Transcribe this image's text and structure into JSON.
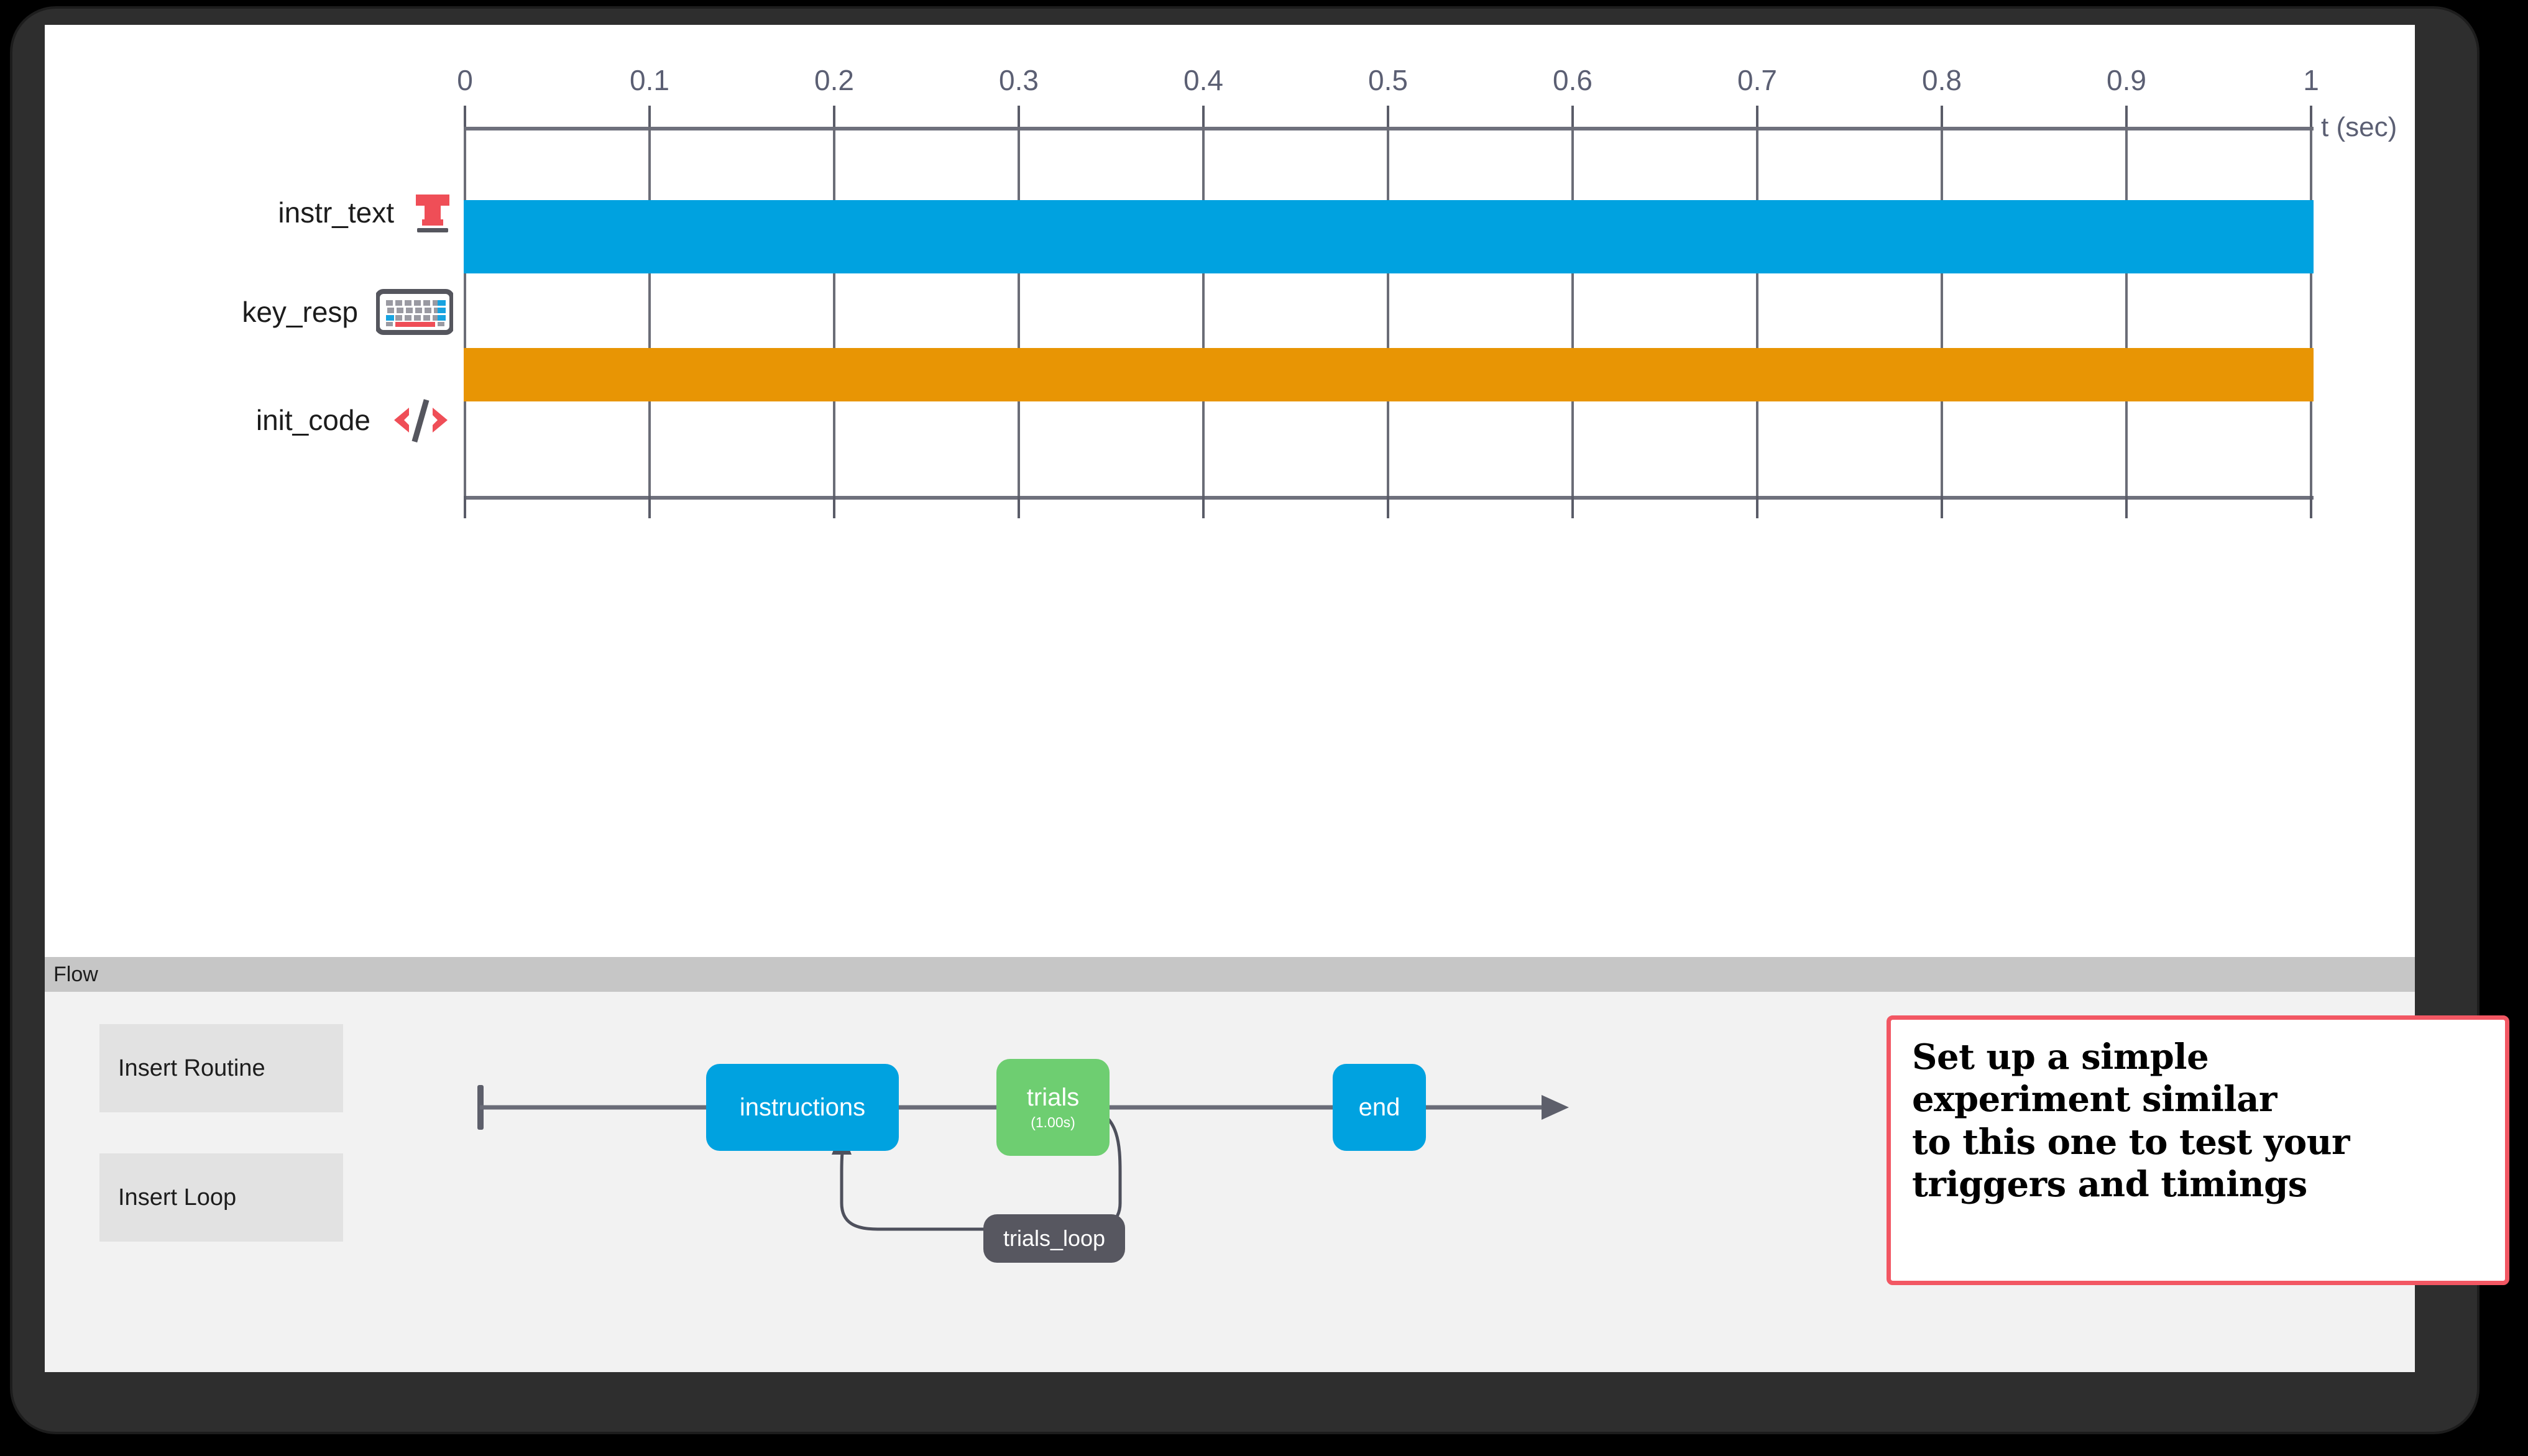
{
  "window": {
    "timeline_panel": {
      "axis": {
        "ticks": [
          "0",
          "0.1",
          "0.2",
          "0.3",
          "0.4",
          "0.5",
          "0.6",
          "0.7",
          "0.8",
          "0.9",
          "1"
        ],
        "unit_label": "t (sec)",
        "t_min": 0,
        "t_max": 1
      },
      "components": [
        {
          "name": "instr_text",
          "icon": "text-component-icon",
          "bar_color": "#00a2e0",
          "start": 0,
          "end": 1
        },
        {
          "name": "key_resp",
          "icon": "keyboard-icon",
          "bar_color": "#e89504",
          "start": 0,
          "end": 1
        },
        {
          "name": "init_code",
          "icon": "code-icon",
          "bar_color": null,
          "start": null,
          "end": null
        }
      ]
    },
    "flow_header": {
      "title": "Flow"
    },
    "flow_panel": {
      "buttons": [
        {
          "label": "Insert Routine"
        },
        {
          "label": "Insert Loop"
        }
      ],
      "nodes": [
        {
          "label": "instructions",
          "sub": "",
          "color": "#00a2e0"
        },
        {
          "label": "trials",
          "sub": "(1.00s)",
          "color": "#6ece71"
        },
        {
          "label": "end",
          "sub": "",
          "color": "#00a2e0"
        }
      ],
      "loop": {
        "label": "trials_loop",
        "color": "#575760"
      }
    }
  },
  "annotation": {
    "lines": [
      "Set up a simple",
      "experiment similar",
      "to this one to test your",
      "triggers and timings"
    ],
    "border_color": "#f25763"
  },
  "chart_data": {
    "type": "bar",
    "title": "",
    "xlabel": "t (sec)",
    "ylabel": "",
    "xlim": [
      0,
      1
    ],
    "categories": [
      "instr_text",
      "key_resp",
      "init_code"
    ],
    "series": [
      {
        "name": "instr_text",
        "start": 0,
        "end": 1,
        "color": "#00a2e0"
      },
      {
        "name": "key_resp",
        "start": 0,
        "end": 1,
        "color": "#e89504"
      },
      {
        "name": "init_code",
        "start": null,
        "end": null,
        "color": null
      }
    ],
    "xticks": [
      "0",
      "0.1",
      "0.2",
      "0.3",
      "0.4",
      "0.5",
      "0.6",
      "0.7",
      "0.8",
      "0.9",
      "1"
    ],
    "grid": true,
    "legend": "none"
  }
}
